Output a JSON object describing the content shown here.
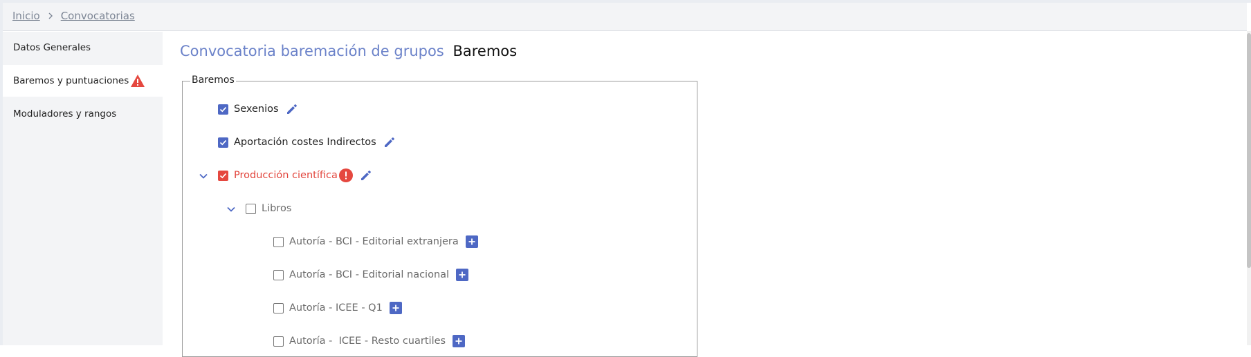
{
  "breadcrumb": {
    "items": [
      "Inicio",
      "Convocatorias"
    ]
  },
  "sidebar": {
    "items": [
      {
        "label": "Datos Generales",
        "active": false
      },
      {
        "label": "Baremos y puntuaciones",
        "active": true,
        "icon": "warning-icon"
      },
      {
        "label": "Moduladores y rangos",
        "active": false
      }
    ]
  },
  "header": {
    "title": "Convocatoria baremación de grupos",
    "subtitle": "Baremos"
  },
  "baremos": {
    "legend": "Baremos",
    "items": [
      {
        "label": "Sexenios",
        "checked": true,
        "action": "edit-icon"
      },
      {
        "label": "Aportación costes Indirectos",
        "checked": true,
        "action": "edit-icon"
      },
      {
        "label": "Producción científica",
        "checked": true,
        "error": true,
        "expanded": true,
        "action": "edit-icon"
      },
      {
        "label": "Libros",
        "checked": false,
        "expanded": true
      },
      {
        "label": "Autoría - BCI - Editorial extranjera",
        "checked": false,
        "action": "add-icon"
      },
      {
        "label": "Autoría - BCI - Editorial nacional",
        "checked": false,
        "action": "add-icon"
      },
      {
        "label": "Autoría - ICEE - Q1",
        "checked": false,
        "action": "add-icon"
      },
      {
        "label": "Autoría -  ICEE - Resto cuartiles",
        "checked": false,
        "action": "add-icon"
      }
    ]
  },
  "colors": {
    "accent": "#4e68c4",
    "title_accent": "#6b82c9",
    "error": "#e5483f",
    "sidebar_bg": "#f3f4f6"
  }
}
